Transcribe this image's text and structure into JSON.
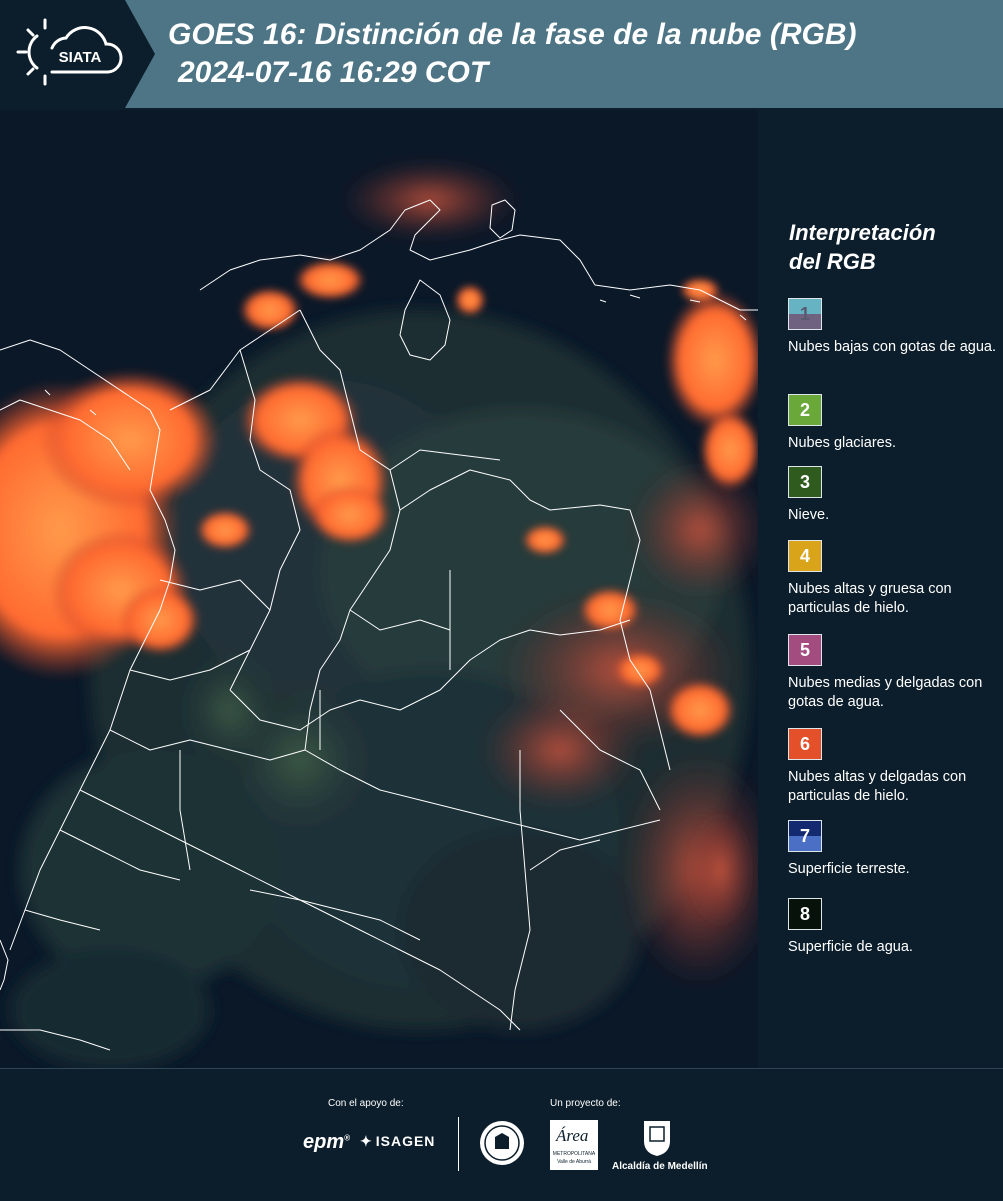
{
  "header": {
    "logo_text": "SIATA",
    "title_line1": "GOES 16: Distinción de la fase de la nube (RGB)",
    "title_line2": "2024-07-16 16:29 COT"
  },
  "panel": {
    "title_line1": "Interpretación",
    "title_line2": "del RGB",
    "items": [
      {
        "number": "1",
        "label": "Nubes bajas con gotas de agua.",
        "color_top": "#66b3c4",
        "color_bottom": "#6e6280"
      },
      {
        "number": "2",
        "label": "Nubes glaciares.",
        "color_top": "#6aa83a",
        "color_bottom": "#6aa83a"
      },
      {
        "number": "3",
        "label": "Nieve.",
        "color_top": "#2f5b1e",
        "color_bottom": "#2f5b1e"
      },
      {
        "number": "4",
        "label": "Nubes altas y gruesa con particulas de hielo.",
        "color_top": "#d9a419",
        "color_bottom": "#d9a419"
      },
      {
        "number": "5",
        "label": "Nubes medias y delgadas con gotas de agua.",
        "color_top": "#a24c80",
        "color_bottom": "#a24c80"
      },
      {
        "number": "6",
        "label": "Nubes altas y delgadas con particulas de hielo.",
        "color_top": "#e4502a",
        "color_bottom": "#e4502a"
      },
      {
        "number": "7",
        "label": "Superficie terreste.",
        "color_top": "#142a70",
        "color_bottom": "#4a6fc4"
      },
      {
        "number": "8",
        "label": "Superficie de agua.",
        "color_top": "#06120a",
        "color_bottom": "#06120a"
      }
    ]
  },
  "footer": {
    "support_label": "Con el apoyo de:",
    "project_label": "Un proyecto de:",
    "sponsor1": "epm",
    "sponsor2": "ISAGEN",
    "partner1": "METROPOLITANA",
    "partner1_script": "Área",
    "partner1_sub": "Valle de Aburrá",
    "partner2": "Alcaldía de Medellín"
  },
  "colors": {
    "header_bg": "#4d7585",
    "logo_tab_bg": "#0c1e2b",
    "panel_bg": "#0c1e2b",
    "cloud_orange": "#ff7a3a",
    "boundary": "#ffffff"
  }
}
